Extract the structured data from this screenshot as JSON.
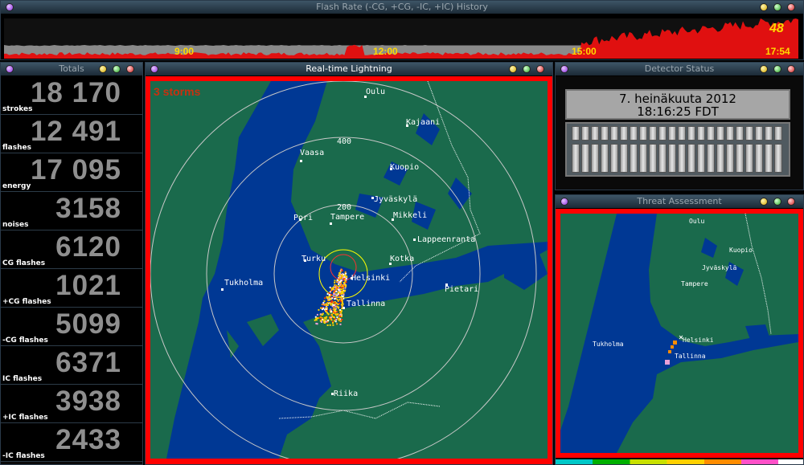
{
  "colors": {
    "accent_red": "#ff0000",
    "sea": "#003894",
    "land": "#1a6a4c",
    "storm": "#ffd400",
    "title_active": "#ffffff"
  },
  "flash_history": {
    "title": "Flash Rate (-CG, +CG, -IC, +IC) History",
    "ticks": [
      "9:00",
      "12:00",
      "15:00"
    ],
    "current_value": "48",
    "current_time": "17:54",
    "rate_series": [
      0.62,
      0.6,
      0.58,
      0.6,
      0.59,
      0.61,
      0.6,
      0.58,
      0.57,
      0.59,
      0.6,
      0.6,
      0.58,
      0.59,
      0.57,
      0.58,
      0.6,
      0.59,
      0.58,
      0.6,
      0.62,
      0.6,
      0.59,
      0.58,
      0.6,
      0.61,
      0.59,
      0.6,
      0.58,
      0.6,
      0.59,
      0.61,
      0.62,
      0.6,
      0.59,
      0.6,
      0.61,
      0.6,
      0.62,
      0.6,
      0.58,
      0.6,
      0.61,
      0.6,
      0.58,
      0.6,
      0.62,
      0.6,
      0.58,
      0.59,
      0.6,
      0.62,
      0.6,
      0.58,
      0.6,
      0.59,
      0.62,
      0.6,
      0.6,
      0.59,
      0.6,
      0.61,
      0.59,
      0.6,
      0.6,
      0.62,
      0.6,
      0.59,
      0.58,
      0.6,
      0.62,
      0.61,
      0.6,
      0.6,
      0.62,
      0.6,
      0.58,
      0.59,
      0.6,
      0.6,
      0.62,
      0.6,
      0.59,
      0.58,
      0.6,
      0.6,
      0.6,
      0.62,
      0.6,
      0.58,
      0.6,
      0.6,
      0.62,
      0.6,
      0.6,
      0.58,
      0.6,
      0.6,
      0.61,
      0.6,
      0.6,
      0.62,
      0.6,
      0.6,
      0.58,
      0.6,
      0.62,
      0.6,
      0.6,
      0.6,
      0.62,
      0.6,
      0.6,
      0.58,
      0.6,
      0.6,
      0.6,
      0.62,
      0.6,
      0.6,
      0.6,
      0.6,
      0.6,
      0.61,
      0.6,
      0.6,
      0.62,
      0.6,
      0.6,
      0.6,
      0.58,
      0.6,
      0.6,
      0.62,
      0.6,
      0.6,
      0.6,
      0.6,
      0.6,
      0.62,
      0.6,
      0.6,
      0.6,
      0.6,
      0.62,
      0.6,
      0.6,
      0.6,
      0.6,
      0.6,
      0.62,
      0.6,
      0.6,
      0.6,
      0.6,
      0.6,
      0.6,
      0.6,
      0.6,
      0.62,
      0.6,
      0.6,
      0.6,
      0.6,
      0.6,
      0.6,
      0.6,
      0.62,
      0.6,
      0.6,
      0.6,
      0.6,
      0.6,
      0.6,
      0.6,
      0.6,
      0.6,
      0.6,
      0.6,
      0.6,
      0.6,
      0.6,
      0.6,
      0.6,
      0.6,
      0.6,
      0.6,
      0.6,
      0.6,
      0.6,
      0.6,
      0.6,
      0.6,
      0.6,
      0.6,
      0.6,
      0.6,
      0.6,
      0.6,
      0.6,
      0.6,
      0.6,
      0.6,
      0.6,
      0.6,
      0.6,
      0.6,
      0.6,
      0.6,
      0.6,
      0.6,
      0.6,
      0.6,
      0.6,
      0.6,
      0.6,
      0.6,
      0.6,
      0.6,
      0.6,
      0.6,
      0.6,
      0.6,
      0.6,
      0.6,
      0.6,
      0.6,
      0.6,
      0.6,
      0.6,
      0.6,
      0.6,
      0.6,
      0.6,
      0.6,
      0.6,
      0.6,
      0.6,
      0.6,
      0.6,
      0.6,
      0.6,
      0.6,
      0.6,
      0.6,
      0.6,
      0.6,
      0.6,
      0.6,
      0.6,
      0.6,
      0.6,
      0.6,
      0.6,
      0.6,
      0.6,
      0.6,
      0.6,
      0.6,
      0.6,
      0.6,
      0.6,
      0.6,
      0.6,
      0.6,
      0.6,
      0.6,
      0.6,
      0.6,
      0.6,
      0.6,
      0.6,
      0.6,
      0.6,
      0.6,
      0.6,
      0.6,
      0.6,
      0.6,
      0.6,
      0.6,
      0.6,
      0.6,
      0.6,
      0.6,
      0.6,
      0.6,
      0.6,
      0.6,
      0.6,
      0.6,
      0.6,
      0.6,
      0.6,
      0.6,
      0.6,
      0.6,
      0.6,
      0.6,
      0.6,
      0.6,
      0.6,
      0.6,
      0.6,
      0.6,
      0.6,
      0.6,
      0.6,
      0.6,
      0.6,
      0.6,
      0.6,
      0.6,
      0.6,
      0.6,
      0.6
    ]
  },
  "totals": {
    "title": "Totals",
    "rows": [
      {
        "value": "18 170",
        "label": "strokes"
      },
      {
        "value": "12 491",
        "label": "flashes"
      },
      {
        "value": "17 095",
        "label": "energy"
      },
      {
        "value": "3158",
        "label": "noises"
      },
      {
        "value": "6120",
        "label": "CG flashes"
      },
      {
        "value": "1021",
        "label": "+CG flashes"
      },
      {
        "value": "5099",
        "label": "-CG flashes"
      },
      {
        "value": "6371",
        "label": "IC flashes"
      },
      {
        "value": "3938",
        "label": "+IC flashes"
      },
      {
        "value": "2433",
        "label": "-IC flashes"
      }
    ]
  },
  "lightning": {
    "title": "Real-time Lightning",
    "storms_label": "3 storms",
    "ring_labels": [
      "400",
      "200"
    ],
    "cities": [
      "Oulu",
      "Kajaani",
      "Vaasa",
      "Kuopio",
      "Jyväskylä",
      "Pori",
      "Tampere",
      "Mikkeli",
      "Lappeenranta",
      "Turku",
      "Kotka",
      "Helsinki",
      "Pietari",
      "Tukholma",
      "Tallinna",
      "Riika"
    ]
  },
  "detector": {
    "title": "Detector Status",
    "date": "7. heinäkuuta 2012",
    "time": "18:16:25 FDT"
  },
  "threat": {
    "title": "Threat Assessment",
    "cities": [
      "Oulu",
      "Kuopio",
      "Jyväskylä",
      "Tampere",
      "Helsinki",
      "Tukholma",
      "Tallinna"
    ]
  }
}
